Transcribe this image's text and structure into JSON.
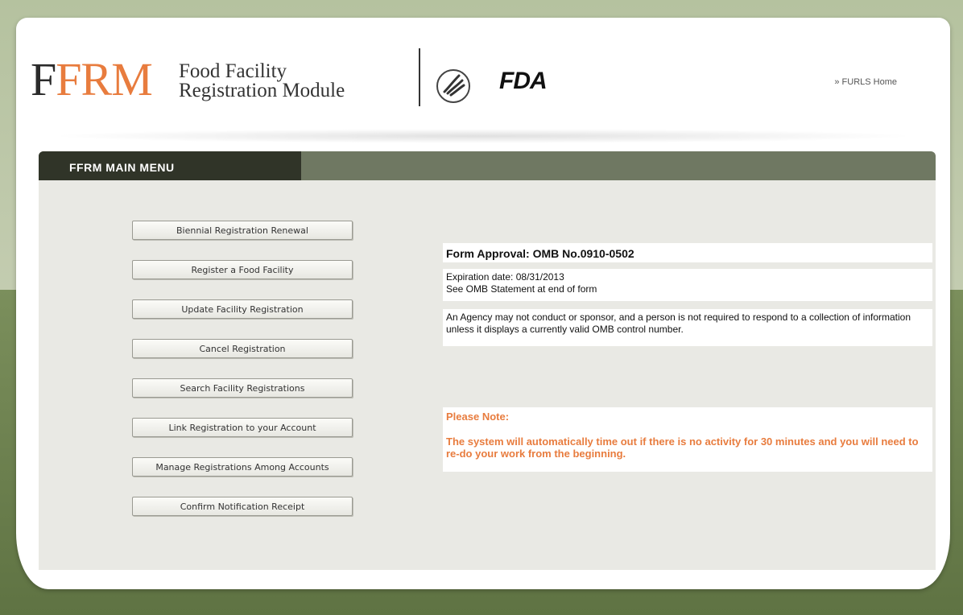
{
  "header": {
    "logo_first": "F",
    "logo_rest": "FRM",
    "logo_line1": "Food Facility",
    "logo_line2": "Registration Module",
    "fda_text": "FDA",
    "furls_link": "» FURLS Home"
  },
  "menu": {
    "title": "FFRM MAIN MENU",
    "buttons": [
      "Biennial Registration Renewal",
      "Register a Food Facility",
      "Update Facility Registration",
      "Cancel Registration",
      "Search Facility Registrations",
      "Link Registration to your Account",
      "Manage Registrations Among Accounts",
      "Confirm Notification Receipt"
    ]
  },
  "info": {
    "form_approval": "Form Approval: OMB No.0910-0502",
    "expiration": "Expiration date: 08/31/2013",
    "omb_statement": "See OMB Statement at end of form",
    "agency_notice": "An Agency may not conduct or sponsor, and a person is not required to respond to a collection of information unless it displays a currently valid OMB control number.",
    "note_title": "Please Note:",
    "note_text": "The system will automatically time out if there is no activity for 30 minutes and you will need to re-do your work from the beginning."
  },
  "colors": {
    "accent_orange": "#e87c3e",
    "menu_tab_dark": "#303428",
    "menu_bar": "#6f7862",
    "background_green": "#6b7f4e"
  },
  "icons": {
    "hhs": "hhs-eagle-icon"
  }
}
